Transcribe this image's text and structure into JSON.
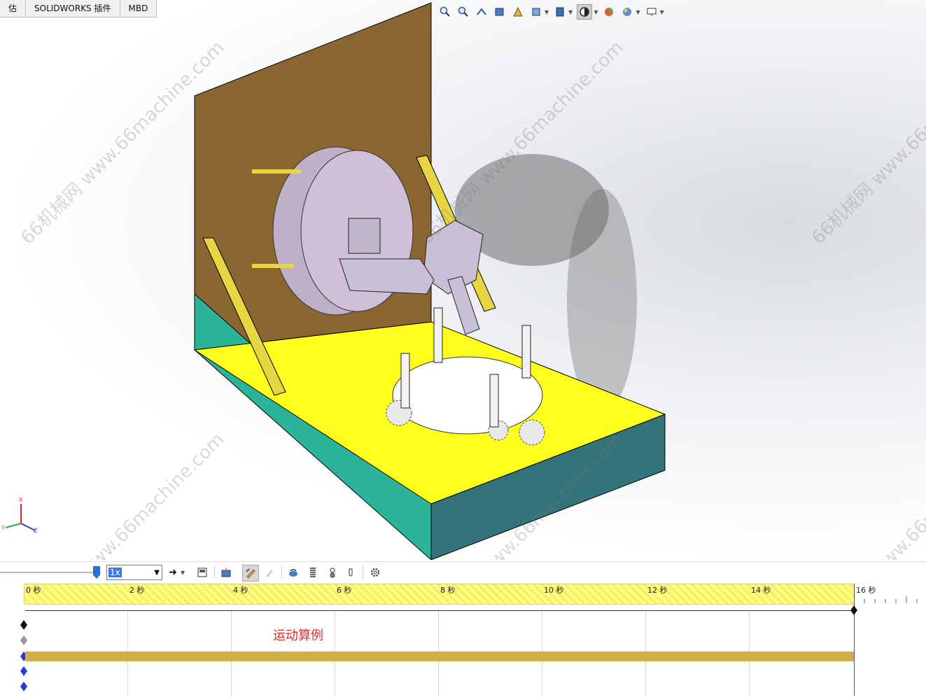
{
  "tabs": [
    "估",
    "SOLIDWORKS 插件",
    "MBD"
  ],
  "hud_icons": [
    "zoom-to-fit-icon",
    "zoom-area-icon",
    "previous-view-icon",
    "section-view-icon",
    "dynamic-annotation-icon",
    "view-orientation-icon",
    "display-style-icon",
    "hide-show-icon",
    "edit-appearance-icon",
    "apply-scene-icon",
    "view-settings-icon"
  ],
  "watermark_text": "66机械网 www.66machine.com",
  "triad_labels": {
    "x": "X",
    "y": "Y",
    "z": "Z"
  },
  "motion_toolbar": {
    "speed_value": "1x",
    "tools": [
      "play-icon",
      "save-animation-icon",
      "animation-wizard-icon",
      "autokey-icon",
      "add-key-icon",
      "motor-icon",
      "spring-icon",
      "contact-icon",
      "gravity-icon",
      "results-icon"
    ]
  },
  "timeline": {
    "tick_labels": [
      "0",
      "2",
      "4",
      "6",
      "8",
      "10",
      "12",
      "14",
      "16"
    ],
    "study_label": "运动算例"
  },
  "colors": {
    "bar": "#d4ad4a",
    "study_label": "#e02a2a",
    "base_top": "#ffff1e",
    "base_side": "#2bb49a",
    "backboard": "#8a6630"
  }
}
